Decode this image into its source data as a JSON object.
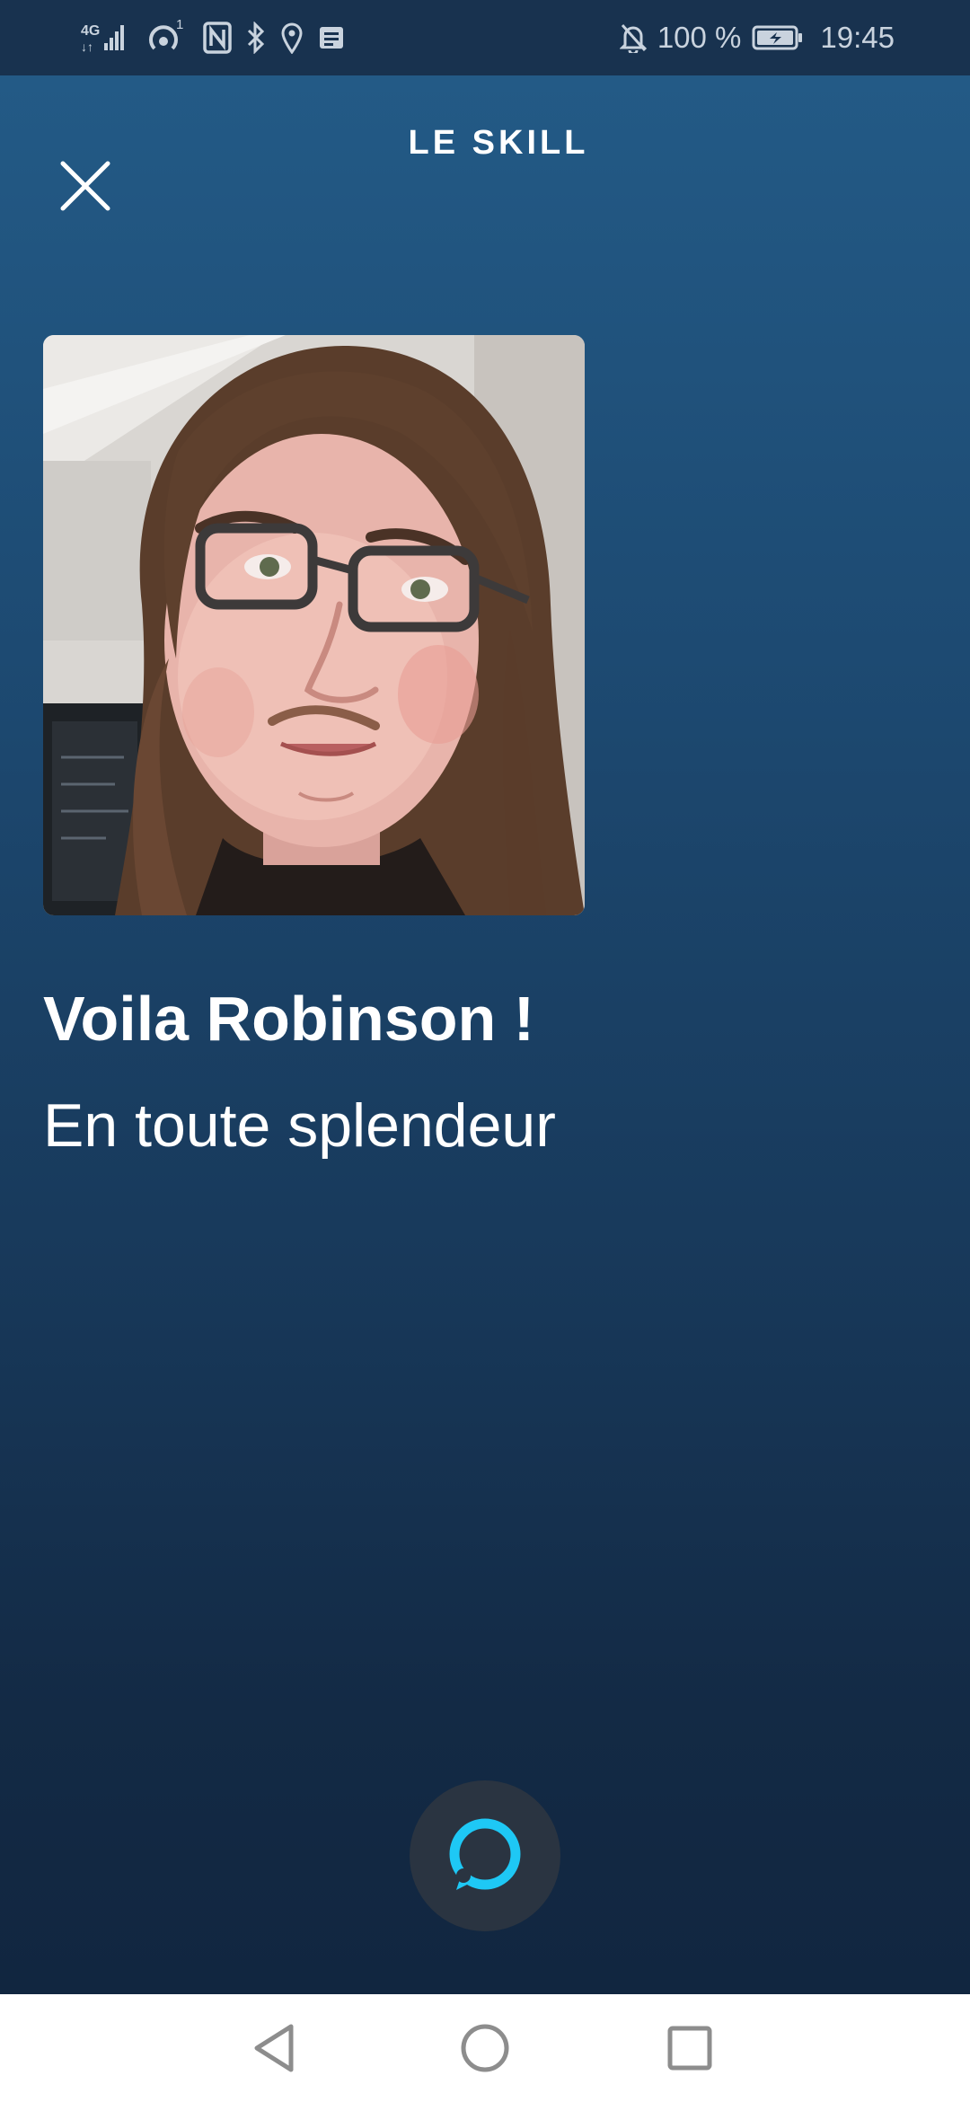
{
  "status_bar": {
    "network_label": "4G",
    "hotspot_badge": "1",
    "battery_percent": "100 %",
    "time": "19:45",
    "icons": [
      "network-4g-icon",
      "signal-icon",
      "hotspot-icon",
      "nfc-icon",
      "bluetooth-icon",
      "location-icon",
      "message-icon",
      "silent-bell-icon",
      "battery-charging-icon"
    ]
  },
  "header": {
    "title": "LE SKILL",
    "close_icon": "close-icon"
  },
  "card": {
    "image_icon": "portrait-photo",
    "title": "Voila Robinson !",
    "subtitle": "En toute splendeur"
  },
  "alexa": {
    "icon": "alexa-ring-icon",
    "accent_color": "#1ec8f5"
  },
  "nav_bar": {
    "icons": [
      "back-icon",
      "home-icon",
      "recents-icon"
    ]
  },
  "colors": {
    "background_top": "#235a86",
    "background_bottom": "#112640",
    "status_bar": "#18324f",
    "text": "#ffffff"
  }
}
